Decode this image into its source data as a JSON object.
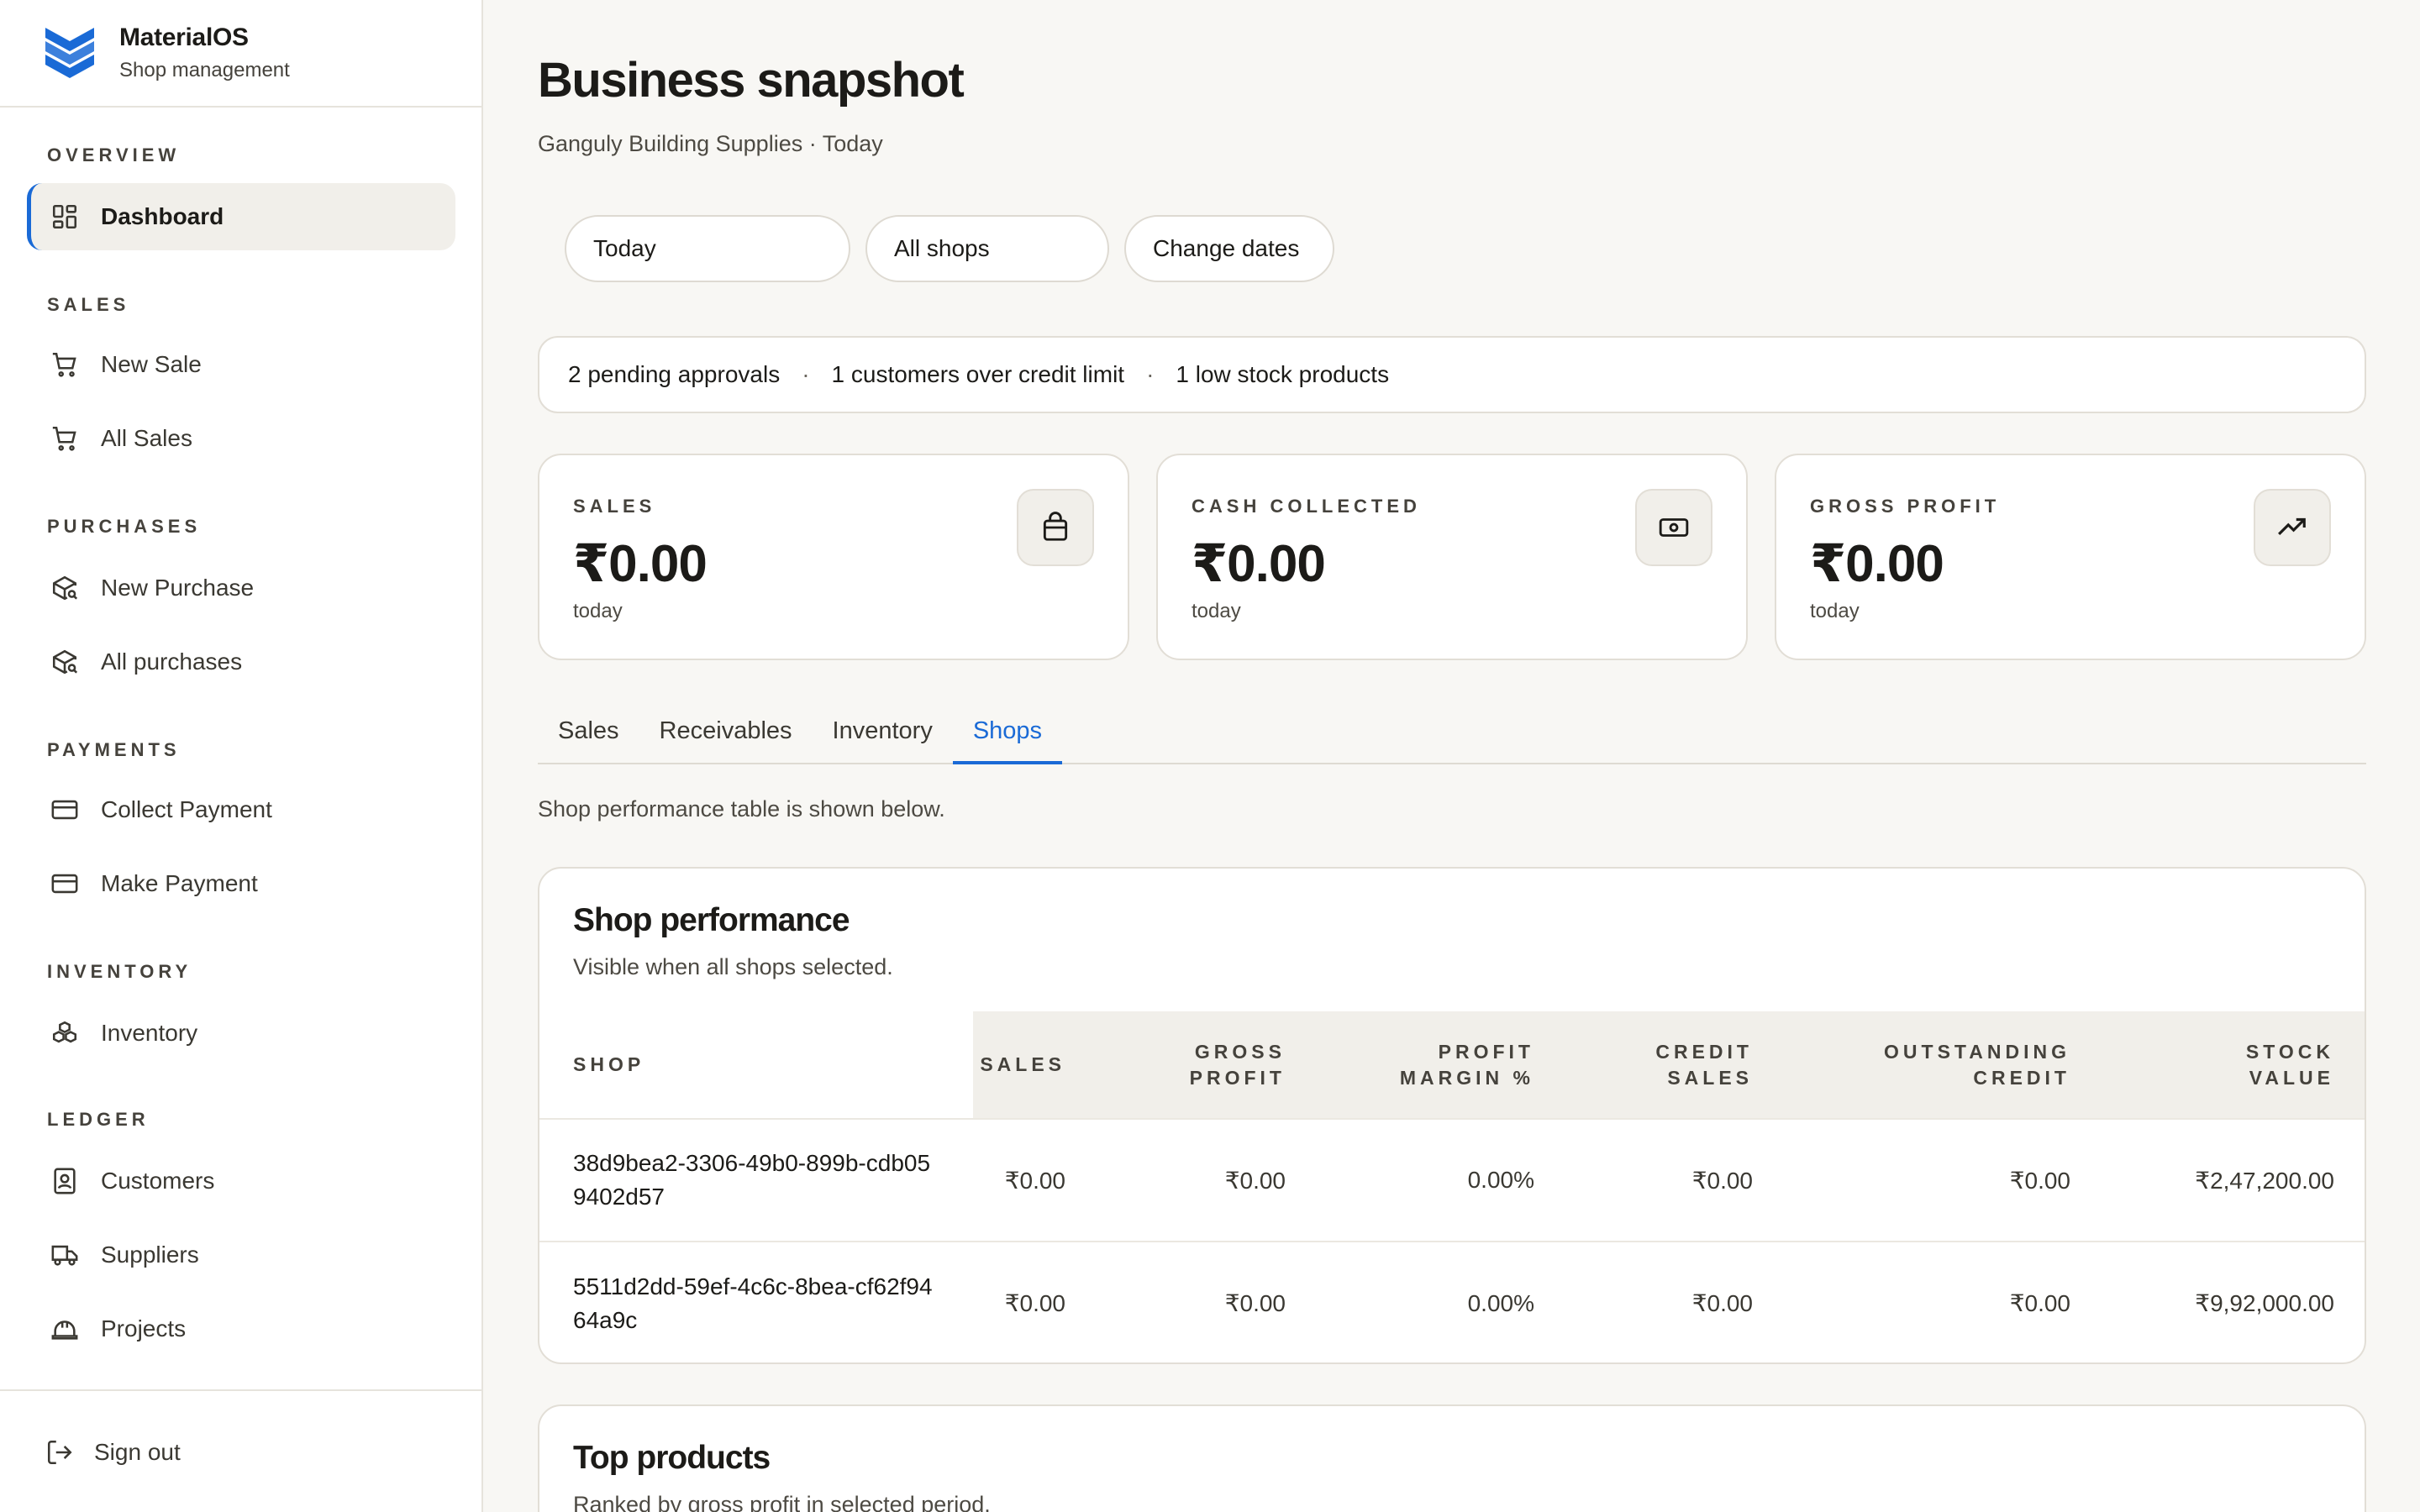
{
  "brand": {
    "name": "MaterialOS",
    "subtitle": "Shop management",
    "accent": "#1a6ad6"
  },
  "sidebar": {
    "sections": [
      {
        "title": "OVERVIEW",
        "items": [
          {
            "label": "Dashboard",
            "icon": "dashboard-icon",
            "active": true
          }
        ]
      },
      {
        "title": "SALES",
        "items": [
          {
            "label": "New Sale",
            "icon": "cart-icon"
          },
          {
            "label": "All Sales",
            "icon": "cart-icon"
          }
        ]
      },
      {
        "title": "PURCHASES",
        "items": [
          {
            "label": "New Purchase",
            "icon": "package-search-icon"
          },
          {
            "label": "All purchases",
            "icon": "package-search-icon"
          }
        ]
      },
      {
        "title": "PAYMENTS",
        "items": [
          {
            "label": "Collect Payment",
            "icon": "credit-card-icon"
          },
          {
            "label": "Make Payment",
            "icon": "credit-card-icon"
          }
        ]
      },
      {
        "title": "INVENTORY",
        "items": [
          {
            "label": "Inventory",
            "icon": "boxes-icon"
          }
        ]
      },
      {
        "title": "LEDGER",
        "items": [
          {
            "label": "Customers",
            "icon": "contact-book-icon"
          },
          {
            "label": "Suppliers",
            "icon": "truck-icon"
          },
          {
            "label": "Projects",
            "icon": "hard-hat-icon"
          }
        ]
      }
    ],
    "sign_out": "Sign out"
  },
  "header": {
    "title": "Business snapshot",
    "subtitle": "Ganguly Building Supplies · Today"
  },
  "filters": {
    "period": "Today",
    "shop": "All shops",
    "change_dates": "Change dates"
  },
  "alerts": {
    "pending": "2 pending approvals",
    "credit": "1 customers over credit limit",
    "stock": "1 low stock products",
    "separator": "·"
  },
  "stats": [
    {
      "label": "SALES",
      "value": "₹0.00",
      "note": "today",
      "icon": "shopping-bag-icon"
    },
    {
      "label": "CASH COLLECTED",
      "value": "₹0.00",
      "note": "today",
      "icon": "banknote-icon"
    },
    {
      "label": "GROSS PROFIT",
      "value": "₹0.00",
      "note": "today",
      "icon": "trending-up-icon"
    }
  ],
  "tabs": [
    "Sales",
    "Receivables",
    "Inventory",
    "Shops"
  ],
  "active_tab": "Shops",
  "tab_note": "Shop performance table is shown below.",
  "shop_performance": {
    "title": "Shop performance",
    "subtitle": "Visible when all shops selected.",
    "columns": [
      [
        "SHOP"
      ],
      [
        "SALES"
      ],
      [
        "GROSS",
        "PROFIT"
      ],
      [
        "PROFIT",
        "MARGIN %"
      ],
      [
        "CREDIT",
        "SALES"
      ],
      [
        "OUTSTANDING",
        "CREDIT"
      ],
      [
        "STOCK",
        "VALUE"
      ]
    ],
    "rows": [
      [
        "38d9bea2-3306-49b0-899b-cdb059402d57",
        "₹0.00",
        "₹0.00",
        "0.00%",
        "₹0.00",
        "₹0.00",
        "₹2,47,200.00"
      ],
      [
        "5511d2dd-59ef-4c6c-8bea-cf62f9464a9c",
        "₹0.00",
        "₹0.00",
        "0.00%",
        "₹0.00",
        "₹0.00",
        "₹9,92,000.00"
      ]
    ]
  },
  "top_products": {
    "title": "Top products",
    "subtitle": "Ranked by gross profit in selected period."
  }
}
